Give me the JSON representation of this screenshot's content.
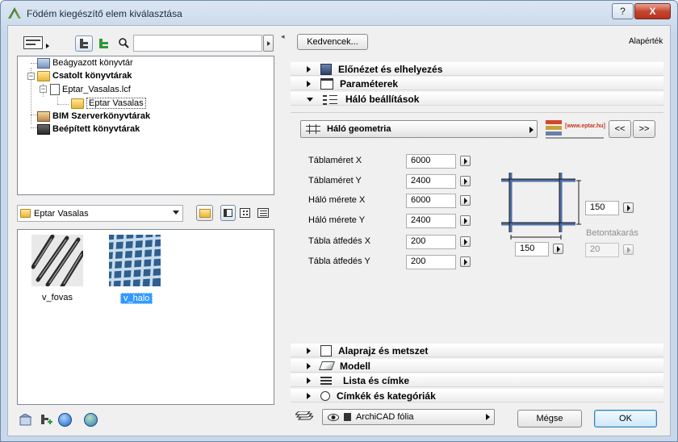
{
  "window": {
    "title": "Födém kiegészítő elem kiválasztása",
    "help_label": "?",
    "close_label": "X"
  },
  "left": {
    "tree": [
      {
        "label": "Beágyazott könyvtár",
        "bold": false
      },
      {
        "label": "Csatolt könyvtárak",
        "bold": true
      },
      {
        "label": "Eptar_Vasalas.lcf",
        "bold": false
      },
      {
        "label": "Eptar Vasalas",
        "bold": false,
        "selected": true
      },
      {
        "label": "BIM Szerverkönyvtárak",
        "bold": true
      },
      {
        "label": "Beépített könyvtárak",
        "bold": true
      }
    ],
    "folder_combo": "Eptar Vasalas",
    "items": [
      {
        "label": "v_fovas",
        "selected": false
      },
      {
        "label": "v_halo",
        "selected": true
      }
    ]
  },
  "right": {
    "favorites_button": "Kedvencek...",
    "defaults_label": "Alapérték",
    "sections_top": [
      {
        "label": "Előnézet és elhelyezés",
        "expanded": false,
        "icon": "preview-placement-icon"
      },
      {
        "label": "Paraméterek",
        "expanded": false,
        "icon": "parameters-icon"
      },
      {
        "label": "Háló beállítások",
        "expanded": true,
        "icon": "mesh-settings-icon"
      }
    ],
    "geometry_button": "Háló geometria",
    "logo_text": "[www.eptar.hu]",
    "prev_label": "<<",
    "next_label": ">>",
    "params": [
      {
        "label": "Táblaméret X",
        "value": "6000"
      },
      {
        "label": "Táblaméret Y",
        "value": "2400"
      },
      {
        "label": "Háló mérete X",
        "value": "6000"
      },
      {
        "label": "Háló mérete Y",
        "value": "2400"
      },
      {
        "label": "Tábla átfedés X",
        "value": "200"
      },
      {
        "label": "Tábla átfedés Y",
        "value": "200"
      }
    ],
    "spacing_y": "150",
    "spacing_x": "150",
    "cover_label": "Betontakarás",
    "cover_value": "20",
    "sections_bottom": [
      {
        "label": "Alaprajz és metszet",
        "icon": "floor-plan-icon"
      },
      {
        "label": "Modell",
        "icon": "model-icon"
      },
      {
        "label": "Lista és címke",
        "icon": "list-label-icon"
      },
      {
        "label": "Címkék és kategóriák",
        "icon": "tags-categories-icon"
      }
    ],
    "layer_value": "ArchiCAD fólia",
    "cancel_label": "Mégse",
    "ok_label": "OK"
  },
  "colors": {
    "accent": "#3399ff",
    "ok_border": "#3c7fb1",
    "mesh_bar": "#4f6ea6"
  }
}
